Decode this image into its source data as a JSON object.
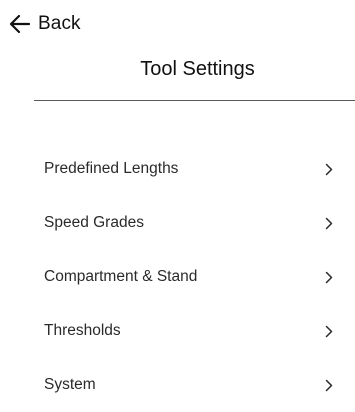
{
  "header": {
    "back_label": "Back",
    "back_icon": "arrow-left-icon",
    "title": "Tool Settings"
  },
  "menu": {
    "chevron_icon": "chevron-right-icon",
    "items": [
      {
        "label": "Predefined Lengths"
      },
      {
        "label": "Speed Grades"
      },
      {
        "label": "Compartment & Stand"
      },
      {
        "label": "Thresholds"
      },
      {
        "label": "System"
      }
    ]
  },
  "colors": {
    "text": "#111111",
    "divider": "#5a5a5a",
    "background": "#ffffff"
  }
}
